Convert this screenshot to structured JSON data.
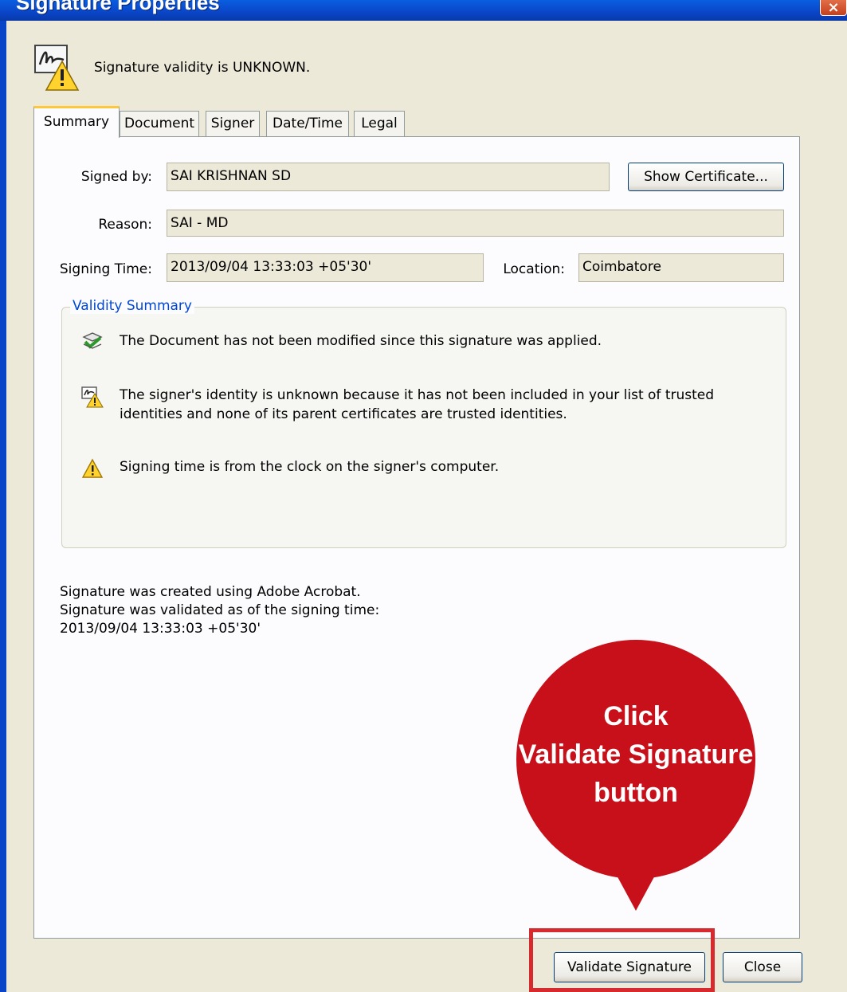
{
  "window": {
    "title": "Signature Properties",
    "close_glyph": "×"
  },
  "header": {
    "status_text": "Signature validity is UNKNOWN.",
    "icon": "signature-warning-icon"
  },
  "tabs": [
    {
      "label": "Summary",
      "active": true
    },
    {
      "label": "Document",
      "active": false
    },
    {
      "label": "Signer",
      "active": false
    },
    {
      "label": "Date/Time",
      "active": false
    },
    {
      "label": "Legal",
      "active": false
    }
  ],
  "summary": {
    "signed_by_label": "Signed by:",
    "signed_by_value": "SAI KRISHNAN SD",
    "show_certificate_label": "Show Certificate...",
    "reason_label": "Reason:",
    "reason_value": "SAI - MD",
    "signing_time_label": "Signing Time:",
    "signing_time_value": "2013/09/04 13:33:03 +05'30'",
    "location_label": "Location:",
    "location_value": "Coimbatore"
  },
  "validity_summary": {
    "title": "Validity Summary",
    "items": [
      {
        "icon": "document-check-icon",
        "text": "The Document has not been modified since this signature was applied."
      },
      {
        "icon": "signer-warning-icon",
        "text": "The signer's identity is unknown because it has not been included in your list of trusted identities and none of its parent certificates are trusted identities."
      },
      {
        "icon": "warning-triangle-icon",
        "text": "Signing time is from the clock on the signer's computer."
      }
    ]
  },
  "footnote": {
    "line1": "Signature was created using Adobe Acrobat.",
    "line2": "Signature was validated as of the signing time:",
    "line3": "2013/09/04 13:33:03 +05'30'"
  },
  "callout": {
    "line1": "Click",
    "line2": "Validate Signature",
    "line3": "button",
    "color": "#c8101a",
    "highlight_color": "#d62a2e"
  },
  "buttons": {
    "validate_label": "Validate Signature",
    "close_label": "Close"
  }
}
